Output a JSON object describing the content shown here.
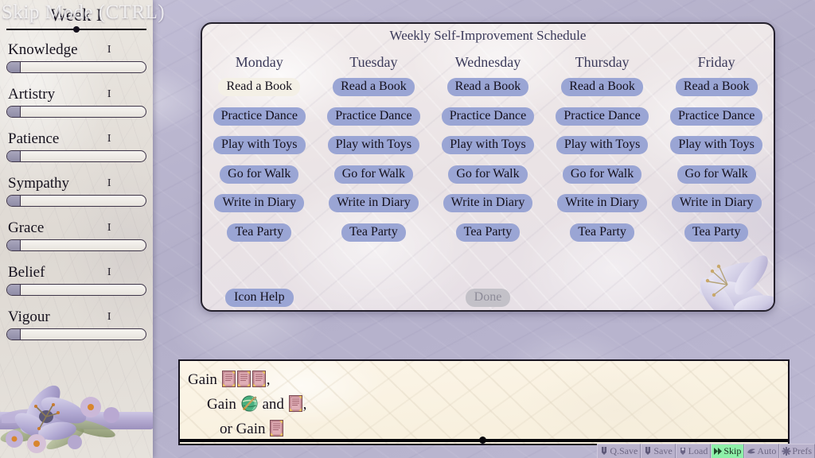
{
  "overlay": {
    "skip_mode_label": "Skip Mode (CTRL)"
  },
  "sidebar": {
    "week_label": "Week I",
    "stats": [
      {
        "name": "Knowledge",
        "value": "I",
        "fill_pct": 10
      },
      {
        "name": "Artistry",
        "value": "I",
        "fill_pct": 10
      },
      {
        "name": "Patience",
        "value": "I",
        "fill_pct": 10
      },
      {
        "name": "Sympathy",
        "value": "I",
        "fill_pct": 10
      },
      {
        "name": "Grace",
        "value": "I",
        "fill_pct": 10
      },
      {
        "name": "Belief",
        "value": "I",
        "fill_pct": 10
      },
      {
        "name": "Vigour",
        "value": "I",
        "fill_pct": 10
      }
    ]
  },
  "schedule": {
    "title": "Weekly Self-Improvement Schedule",
    "days": [
      "Monday",
      "Tuesday",
      "Wednesday",
      "Thursday",
      "Friday"
    ],
    "activities": [
      "Read a Book",
      "Practice Dance",
      "Play with Toys",
      "Go for Walk",
      "Write in Diary",
      "Tea Party"
    ],
    "hovered": {
      "day_index": 0,
      "activity_index": 0
    },
    "icon_help_label": "Icon Help",
    "done_label": "Done",
    "done_enabled": false,
    "button_color": "#9aa5d4",
    "hover_color": "#f4f0e6",
    "disabled_color": "#c3c1c8"
  },
  "dialogue": {
    "lines": [
      {
        "indent": 0,
        "parts": [
          {
            "type": "text",
            "text": "Gain "
          },
          {
            "type": "icon",
            "icon": "book-icon"
          },
          {
            "type": "icon",
            "icon": "book-icon"
          },
          {
            "type": "icon",
            "icon": "book-icon"
          },
          {
            "type": "text",
            "text": ","
          }
        ]
      },
      {
        "indent": 1,
        "parts": [
          {
            "type": "text",
            "text": "Gain "
          },
          {
            "type": "icon",
            "icon": "palette-brush-icon"
          },
          {
            "type": "text",
            "text": " and "
          },
          {
            "type": "icon",
            "icon": "book-icon"
          },
          {
            "type": "text",
            "text": ","
          }
        ]
      },
      {
        "indent": 2,
        "parts": [
          {
            "type": "text",
            "text": "or Gain "
          },
          {
            "type": "icon",
            "icon": "book-icon"
          }
        ]
      }
    ]
  },
  "quick_menu": {
    "items": [
      {
        "label": "Q.Save",
        "icon": "quicksave-icon",
        "active": false
      },
      {
        "label": "Save",
        "icon": "save-icon",
        "active": false
      },
      {
        "label": "Load",
        "icon": "load-icon",
        "active": false
      },
      {
        "label": "Skip",
        "icon": "skip-icon",
        "active": true
      },
      {
        "label": "Auto",
        "icon": "auto-icon",
        "active": false
      },
      {
        "label": "Prefs",
        "icon": "prefs-icon",
        "active": false
      }
    ],
    "active_color": "#8df0a8"
  }
}
